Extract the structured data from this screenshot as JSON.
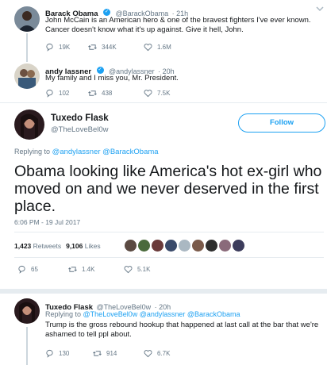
{
  "tweets": [
    {
      "name": "Barack Obama",
      "handle": "@BarackObama",
      "time": "· 21h",
      "text": "John McCain is an American hero & one of the bravest fighters I've ever known. Cancer doesn't know what it's up against. Give it hell, John.",
      "replies": "19K",
      "retweets": "344K",
      "likes": "1.6M"
    },
    {
      "name": "andy lassner",
      "handle": "@andylassner",
      "time": "· 20h",
      "text": "My family and I miss you, Mr. President.",
      "replies": "102",
      "retweets": "438",
      "likes": "7.5K"
    }
  ],
  "main_tweet": {
    "name": "Tuxedo Flask",
    "handle": "@TheLoveBel0w",
    "follow_label": "Follow",
    "replying_prefix": "Replying to",
    "replying_to": "@andylassner @BarackObama",
    "text": "Obama looking like America's hot ex-girl who moved on and we never deserved in the first place.",
    "timestamp": "6:06 PM - 19 Jul 2017",
    "retweets_count": "1,423",
    "retweets_label": "Retweets",
    "likes_count": "9,106",
    "likes_label": "Likes",
    "replies": "65",
    "retweets": "1.4K",
    "likes": "5.1K"
  },
  "reply_tweet": {
    "name": "Tuxedo Flask",
    "handle": "@TheLoveBel0w",
    "time": "· 20h",
    "replying_prefix": "Replying to",
    "replying_to": "@TheLoveBel0w @andylassner @BarackObama",
    "text": "Trump is the gross rebound hookup that happened at last call at the bar that we're ashamed to tell ppl about.",
    "replies": "130",
    "retweets": "914",
    "likes": "6.7K"
  },
  "colors": {
    "accent": "#1da1f2",
    "text": "#14171a",
    "muted": "#657786",
    "border": "#e6ecf0"
  }
}
